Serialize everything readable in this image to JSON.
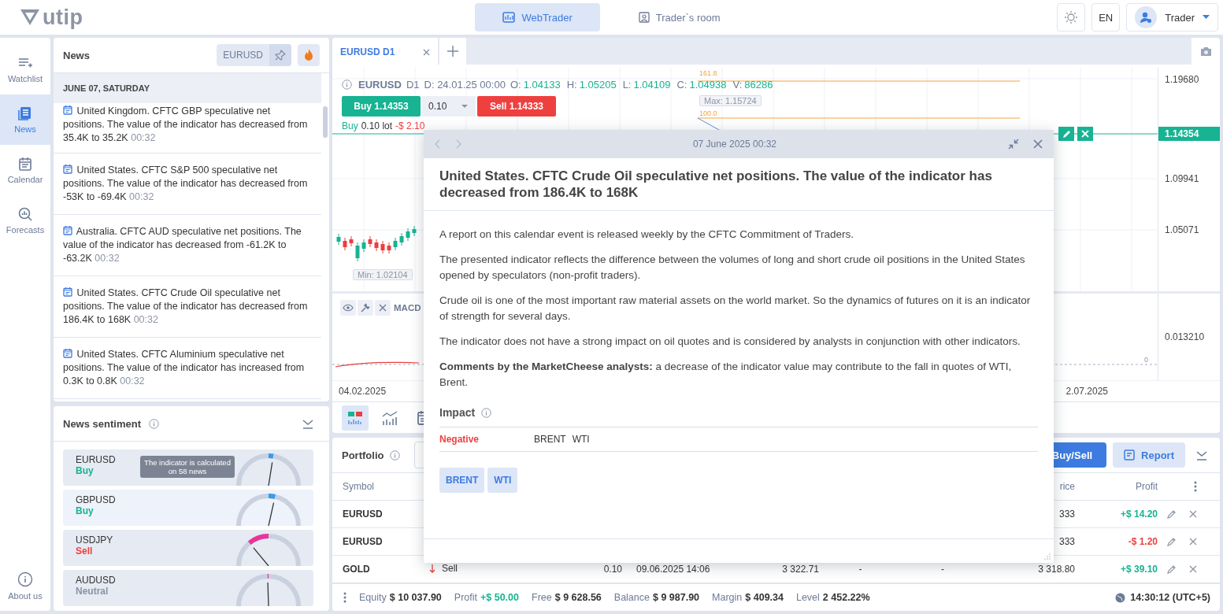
{
  "header": {
    "logo": "utip",
    "tabs": [
      {
        "label": "WebTrader",
        "kind": "terminal",
        "selected": true
      },
      {
        "label": "Trader`s room",
        "kind": "room",
        "selected": false
      }
    ],
    "language": "EN",
    "user": "Trader"
  },
  "nav": {
    "items": [
      {
        "label": "Watchlist",
        "kind": "watchlist",
        "selected": false
      },
      {
        "label": "News",
        "kind": "news",
        "selected": true
      },
      {
        "label": "Calendar",
        "kind": "calendar",
        "selected": false
      },
      {
        "label": "Forecasts",
        "kind": "forecasts",
        "selected": false
      }
    ],
    "about": "About us"
  },
  "news": {
    "title": "News",
    "symbol_filter": "EURUSD",
    "date_header": "JUNE 07, SATURDAY",
    "items": [
      {
        "text": "United Kingdom. CFTC GBP speculative net positions. The value of the indicator has decreased from 35.4K to 35.2K",
        "time": "00:32"
      },
      {
        "text": "United States. CFTC S&P 500 speculative net positions. The value of the indicator has decreased from -53K to -69.4K",
        "time": "00:32"
      },
      {
        "text": "Australia. CFTC AUD speculative net positions. The value of the indicator has decreased from -61.2K to -63.2K",
        "time": "00:32"
      },
      {
        "text": "United States. CFTC Crude Oil speculative net positions. The value of the indicator has decreased from 186.4K to 168K",
        "time": "00:32"
      },
      {
        "text": "United States. CFTC Aluminium speculative net positions. The value of the indicator has increased from 0.3K to 0.8K",
        "time": "00:32"
      }
    ]
  },
  "sentiment": {
    "title": "News sentiment",
    "tooltip": "The indicator is calculated on 58 news",
    "items": [
      {
        "symbol": "EURUSD",
        "signal": "Buy",
        "kind": "buy",
        "level": 0.55
      },
      {
        "symbol": "GBPUSD",
        "signal": "Buy",
        "kind": "buy",
        "level": 0.57
      },
      {
        "symbol": "USDJPY",
        "signal": "Sell",
        "kind": "sell",
        "level": 0.28
      },
      {
        "symbol": "AUDUSD",
        "signal": "Neutral",
        "kind": "neutral",
        "level": 0.49
      }
    ]
  },
  "chart": {
    "tab": "EURUSD D1",
    "symbol": "EURUSD",
    "timeframe": "D1",
    "date": "D: 24.01.25 00:00",
    "ohlcv": [
      {
        "label": "O:",
        "value": "1.04133"
      },
      {
        "label": "H:",
        "value": "1.05205"
      },
      {
        "label": "L:",
        "value": "1.04109"
      },
      {
        "label": "C:",
        "value": "1.04938"
      },
      {
        "label": "V:",
        "value": "86286"
      }
    ],
    "buy": "Buy 1.14353",
    "lot": "0.10",
    "sell": "Sell 1.14333",
    "position": {
      "side": "Buy",
      "volume": "0.10 lot",
      "profit": "-$ 2.10"
    },
    "fib_levels": [
      "161.8",
      "100.0"
    ],
    "max_label": "Max: 1.15724",
    "min_label": "Min: 1.02104",
    "price_ticks": [
      "1.19680",
      "1.09941",
      "1.05071"
    ],
    "current_price": "1.14354",
    "indicator": {
      "name": "MACD",
      "tick": "0.013210",
      "zero": "0"
    },
    "date_ticks": [
      "04.02.2025",
      "2.07.2025"
    ],
    "toolbar": [
      {
        "kind": "candles",
        "selected": true
      },
      {
        "kind": "indicator",
        "selected": false
      },
      {
        "kind": "calendar",
        "selected": false
      }
    ]
  },
  "portfolio": {
    "title": "Portfolio",
    "buy_sell": "Buy/Sell",
    "report": "Report",
    "columns": {
      "symbol": "Symbol",
      "price": "rice",
      "profit": "Profit"
    },
    "rows": [
      {
        "symbol": "EURUSD",
        "price": "333",
        "profit": "+$ 14.20",
        "loss": false
      },
      {
        "symbol": "EURUSD",
        "price": "333",
        "profit": "-$ 1.20",
        "loss": true
      },
      {
        "symbol": "GOLD",
        "side": "Sell",
        "short": true,
        "volume": "0.10",
        "open_time": "09.06.2025 14:06",
        "open_price": "3 322.71",
        "sl": "-",
        "tp": "-",
        "price": "3 318.80",
        "profit": "+$ 39.10",
        "loss": false
      }
    ]
  },
  "status_bar": {
    "items": [
      {
        "label": "Equity",
        "value": "$ 10 037.90",
        "kind": "plain"
      },
      {
        "label": "Profit",
        "value": "+$ 50.00",
        "kind": "gain"
      },
      {
        "label": "Free",
        "value": "$ 9 628.56",
        "kind": "plain"
      },
      {
        "label": "Balance",
        "value": "$ 9 987.90",
        "kind": "plain"
      },
      {
        "label": "Margin",
        "value": "$ 409.34",
        "kind": "plain"
      },
      {
        "label": "Level",
        "value": "2 452.22%",
        "kind": "plain"
      }
    ],
    "clock": "14:30:12 (UTC+5)"
  },
  "modal": {
    "date": "07 June 2025 00:32",
    "title": "United States. CFTC Crude Oil speculative net positions. The value of the indicator has decreased from 186.4K to 168K",
    "paragraphs": [
      "A report on this calendar event is released weekly by the CFTC Commitment of Traders.",
      "The presented indicator reflects the difference between the volumes of long and short crude oil positions in the United States opened by speculators (non-profit traders).",
      "Crude oil is one of the most important raw material assets on the world market. So the dynamics of futures on it is an indicator of strength for several days.",
      "The indicator does not have a strong impact on oil quotes and is considered by analysts in conjunction with other indicators.",
      "**Comments by the MarketCheese analysts:** a decrease of the indicator value may contribute to the fall in quotes of WTI, Brent."
    ],
    "impact_title": "Impact",
    "impact": {
      "label": "Negative",
      "kind": "negative",
      "instruments": [
        "BRENT",
        "WTI"
      ]
    },
    "tags": [
      "BRENT",
      "WTI"
    ]
  }
}
